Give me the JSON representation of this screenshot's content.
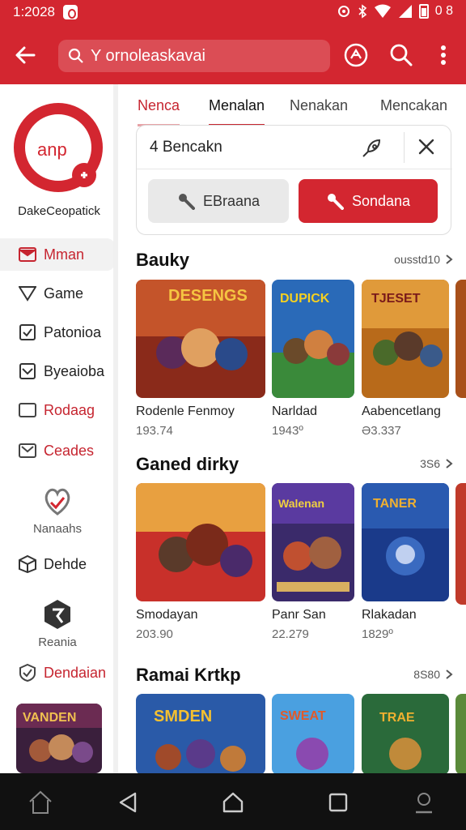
{
  "status": {
    "time": "1:2028",
    "right_text": "0 8"
  },
  "appbar": {
    "search_text": "Y ornoleaskavai"
  },
  "sidebar": {
    "brand_logo_text": "anp",
    "brand_name": "DakeCeopatick",
    "items": [
      {
        "label": "Mman"
      },
      {
        "label": "Game"
      },
      {
        "label": "Patonioa"
      },
      {
        "label": "Byeaioba"
      },
      {
        "label": "Rodaag"
      },
      {
        "label": "Ceades"
      },
      {
        "label": "Nanaahs"
      },
      {
        "label": "Dehde"
      },
      {
        "label": "Reania"
      },
      {
        "label": "Dendaian"
      }
    ]
  },
  "tabs": [
    {
      "label": "Nenca"
    },
    {
      "label": "Menalan"
    },
    {
      "label": "Nenakan"
    },
    {
      "label": "Mencakan"
    }
  ],
  "filter": {
    "query": "4 Bencakn",
    "btn_gray": "EBraana",
    "btn_red": "Sondana"
  },
  "sections": [
    {
      "title": "Bauky",
      "more": "ousstd10",
      "games": [
        {
          "title": "Rodenle Fenmoy",
          "stat": "193.74"
        },
        {
          "title": "Narldad",
          "stat": "1943º"
        },
        {
          "title": "Aabencetlang",
          "stat": "Ə3.337"
        }
      ]
    },
    {
      "title": "Ganed dirky",
      "more": "3Ѕ6",
      "games": [
        {
          "title": "Smodayan",
          "stat": "203.90"
        },
        {
          "title": "Panr San",
          "stat": "22.279"
        },
        {
          "title": "Rlakadan",
          "stat": "1829º"
        }
      ]
    },
    {
      "title": "Ramai Krtkp",
      "more": "8Ѕ80",
      "games": [
        {
          "title": "",
          "stat": ""
        },
        {
          "title": "",
          "stat": ""
        },
        {
          "title": "",
          "stat": ""
        }
      ]
    }
  ],
  "art_captions": [
    "DESENGS",
    "DUPICK",
    "TJESET",
    "",
    "",
    "",
    "",
    "SMDEN",
    "SWEAT"
  ],
  "colors": {
    "brand_red": "#d32630",
    "nav_bg": "#111111"
  }
}
